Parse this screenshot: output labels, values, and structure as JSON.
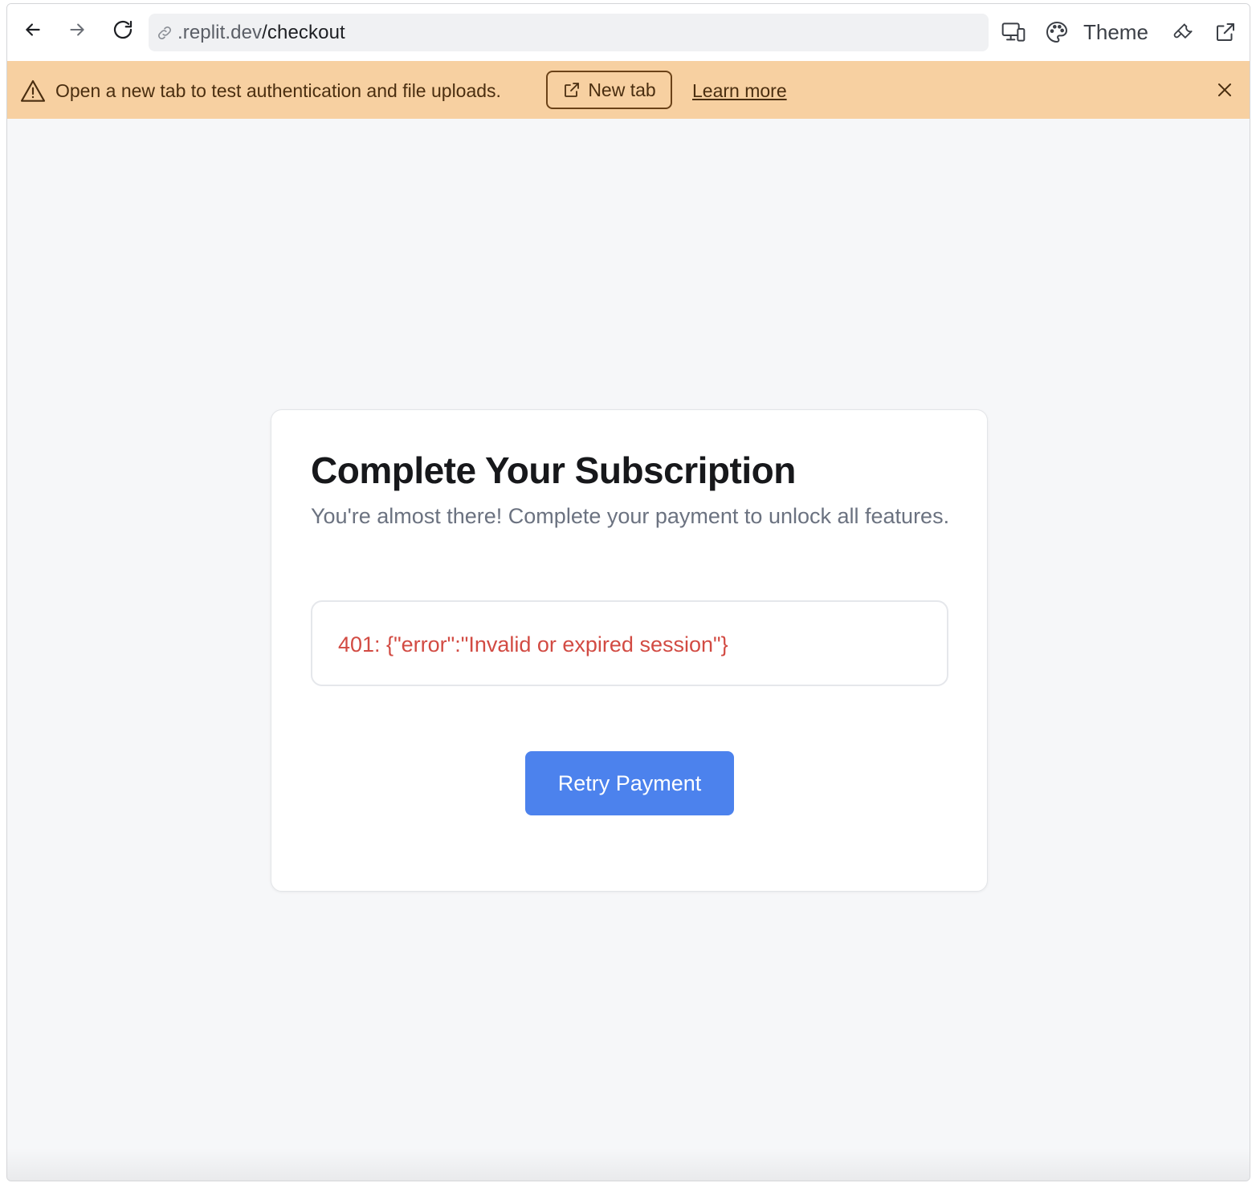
{
  "browser": {
    "url_domain": ".replit.dev",
    "url_path": "/checkout",
    "theme_label": "Theme",
    "icons": [
      "back-arrow-icon",
      "forward-arrow-icon",
      "reload-icon",
      "link-icon",
      "devices-icon",
      "palette-icon",
      "wrench-icon",
      "external-link-icon"
    ]
  },
  "banner": {
    "message": "Open a new tab to test authentication and file uploads.",
    "new_tab_label": "New tab",
    "learn_more_label": "Learn more",
    "background_color": "#f7d0a1"
  },
  "card": {
    "title": "Complete Your Subscription",
    "subtitle": "You're almost there! Complete your payment to unlock all features.",
    "error_message": "401: {\"error\":\"Invalid or expired session\"}",
    "retry_label": "Retry Payment",
    "accent_color": "#4c82ed",
    "error_color": "#d24b43"
  }
}
